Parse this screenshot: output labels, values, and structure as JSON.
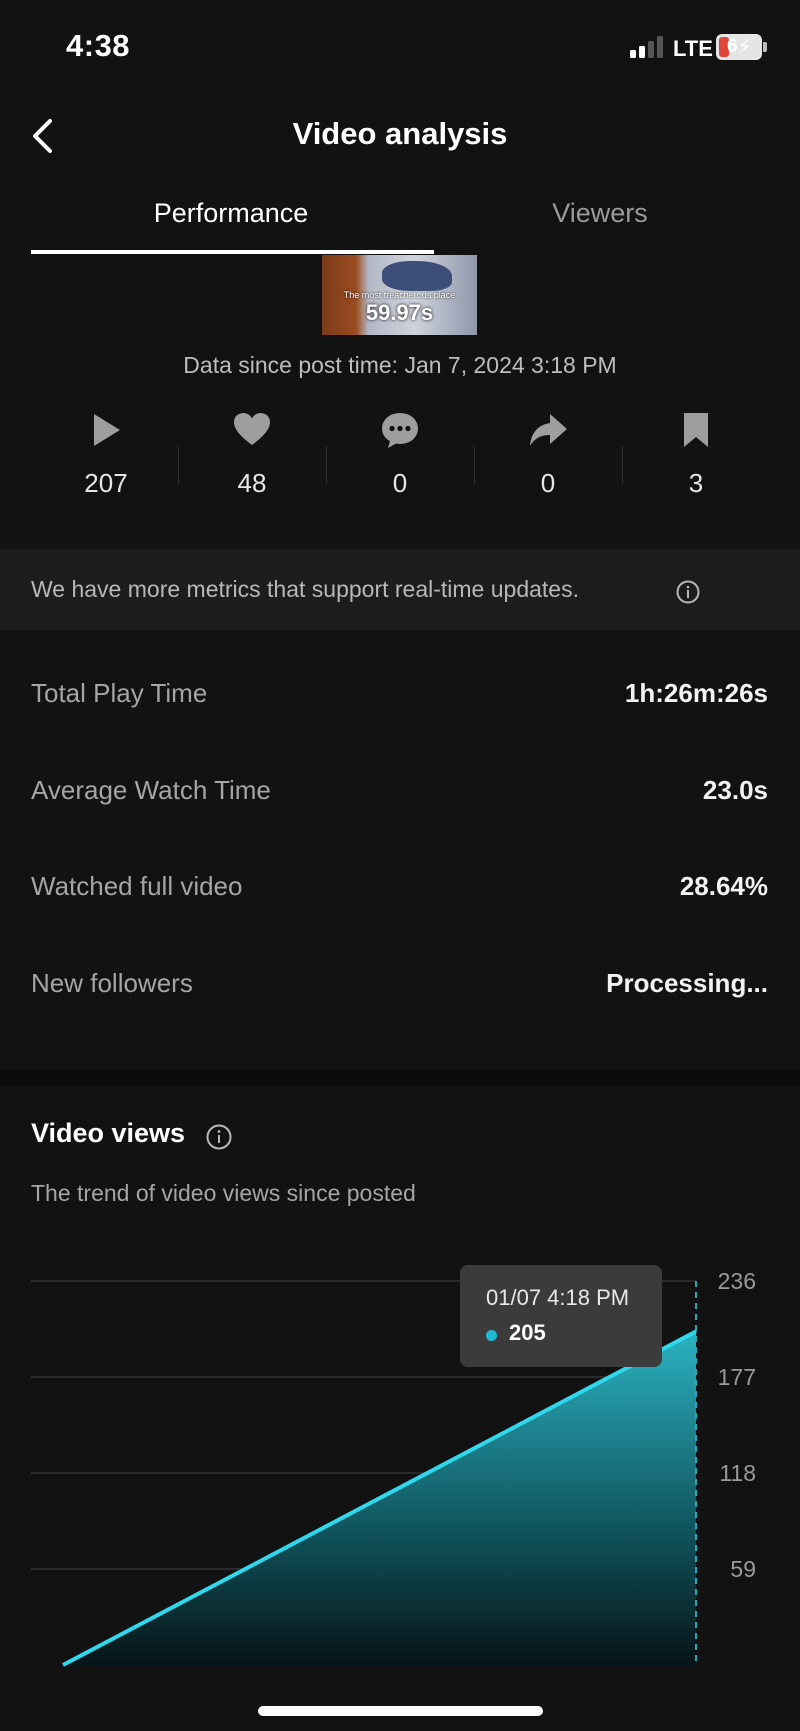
{
  "status_bar": {
    "time": "4:38",
    "network": "LTE",
    "battery": "6"
  },
  "header": {
    "title": "Video analysis"
  },
  "tabs": [
    {
      "label": "Performance",
      "active": true
    },
    {
      "label": "Viewers",
      "active": false
    }
  ],
  "thumbnail": {
    "caption": "The most treacherous place",
    "duration": "59.97s"
  },
  "data_since": "Data since post time: Jan 7, 2024 3:18 PM",
  "stats": [
    {
      "icon": "play-icon",
      "value": "207"
    },
    {
      "icon": "heart-icon",
      "value": "48"
    },
    {
      "icon": "comment-icon",
      "value": "0"
    },
    {
      "icon": "share-icon",
      "value": "0"
    },
    {
      "icon": "bookmark-icon",
      "value": "3"
    }
  ],
  "banner": {
    "text": "We have more metrics that support real-time updates."
  },
  "metrics": [
    {
      "label": "Total Play Time",
      "value": "1h:26m:26s"
    },
    {
      "label": "Average Watch Time",
      "value": "23.0s"
    },
    {
      "label": "Watched full video",
      "value": "28.64%"
    },
    {
      "label": "New followers",
      "value": "Processing..."
    }
  ],
  "video_views": {
    "title": "Video views",
    "subtitle": "The trend of video views since posted",
    "tooltip": {
      "date": "01/07 4:18 PM",
      "value": "205"
    }
  },
  "colors": {
    "accent": "#2fd8ec",
    "background": "#121212"
  },
  "chart_data": {
    "type": "area",
    "title": "Video views",
    "y_ticks": [
      236,
      177,
      118,
      59
    ],
    "ylim": [
      0,
      236
    ],
    "points": [
      {
        "x": 0,
        "y": 0
      },
      {
        "x": 1,
        "y": 205
      }
    ],
    "grid": true,
    "highlight": {
      "label": "01/07 4:18 PM",
      "value": 205
    }
  }
}
